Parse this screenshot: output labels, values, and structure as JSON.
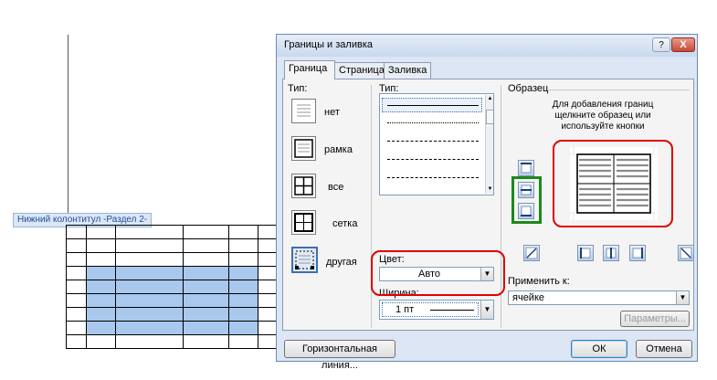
{
  "document": {
    "footer_label": "Нижний колонтитул -Раздел 2-"
  },
  "dialog": {
    "title": "Границы и заливка",
    "help_glyph": "?",
    "close_glyph": "X",
    "tabs": [
      {
        "label": "Граница",
        "active": true
      },
      {
        "label": "Страница",
        "active": false
      },
      {
        "label": "Заливка",
        "active": false
      }
    ],
    "setting": {
      "label": "Тип:",
      "options": [
        {
          "label": "нет",
          "icon": "border-none-icon"
        },
        {
          "label": "рамка",
          "icon": "border-box-icon"
        },
        {
          "label": "все",
          "icon": "border-all-icon"
        },
        {
          "label": "сетка",
          "icon": "border-grid-icon"
        },
        {
          "label": "другая",
          "icon": "border-custom-icon",
          "selected": true
        }
      ]
    },
    "style": {
      "label": "Тип:",
      "items": [
        "solid",
        "dotted",
        "dashed",
        "dash-long",
        "dash-dot"
      ],
      "selected": "solid"
    },
    "color": {
      "label": "Цвет:",
      "value": "Авто"
    },
    "width": {
      "label": "Ширина:",
      "value": "1 пт"
    },
    "preview": {
      "label": "Образец",
      "hint": "Для добавления границ щелкните образец или используйте кнопки"
    },
    "apply_to": {
      "label": "Применить к:",
      "value": "ячейке"
    },
    "buttons": {
      "options": "Параметры...",
      "horizontal_line": "Горизонтальная линия...",
      "ok": "ОК",
      "cancel": "Отмена"
    },
    "highlight_colors": {
      "red": "#e00000",
      "green": "#1a8a1a"
    }
  }
}
